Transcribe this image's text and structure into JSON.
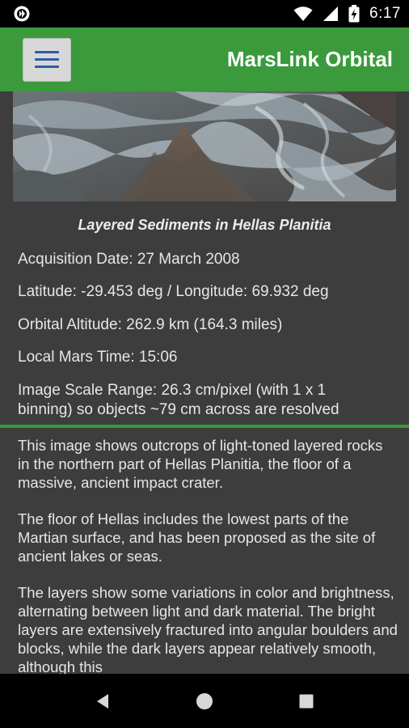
{
  "status_bar": {
    "time": "6:17",
    "icons": [
      "vpn-icon",
      "wifi-icon",
      "signal-icon",
      "battery-charging-icon"
    ]
  },
  "app_bar": {
    "menu_icon": "hamburger-menu-icon",
    "title": "MarsLink Orbital"
  },
  "image": {
    "caption": "Layered Sediments in Hellas Planitia"
  },
  "details": {
    "acquisition": "Acquisition Date: 27 March 2008",
    "coordinates": "Latitude: -29.453 deg / Longitude: 69.932 deg",
    "altitude": "Orbital Altitude: 262.9 km (164.3 miles)",
    "local_time": "Local Mars Time: 15:06",
    "scale_line1": "Image Scale Range: 26.3 cm/pixel (with 1 x 1",
    "scale_line2": "binning) so objects ~79 cm across are resolved"
  },
  "description": {
    "p1": "This image shows outcrops of light-toned layered rocks in the northern part of Hellas Planitia, the floor of a massive, ancient impact crater.",
    "p2": "The floor of Hellas includes the lowest parts of the Martian surface, and has been proposed as the site of ancient lakes or seas.",
    "p3": "The layers show some variations in color and brightness, alternating between light and dark material. The bright layers are extensively fractured into angular boulders and blocks, while the dark layers appear relatively smooth, although this"
  },
  "nav": {
    "back_icon": "back-triangle-icon",
    "home_icon": "home-circle-icon",
    "recents_icon": "recents-square-icon"
  },
  "colors": {
    "accent_green": "#3a9a3c",
    "content_bg": "#3d3d3d",
    "menu_lines": "#2f5aa8"
  }
}
